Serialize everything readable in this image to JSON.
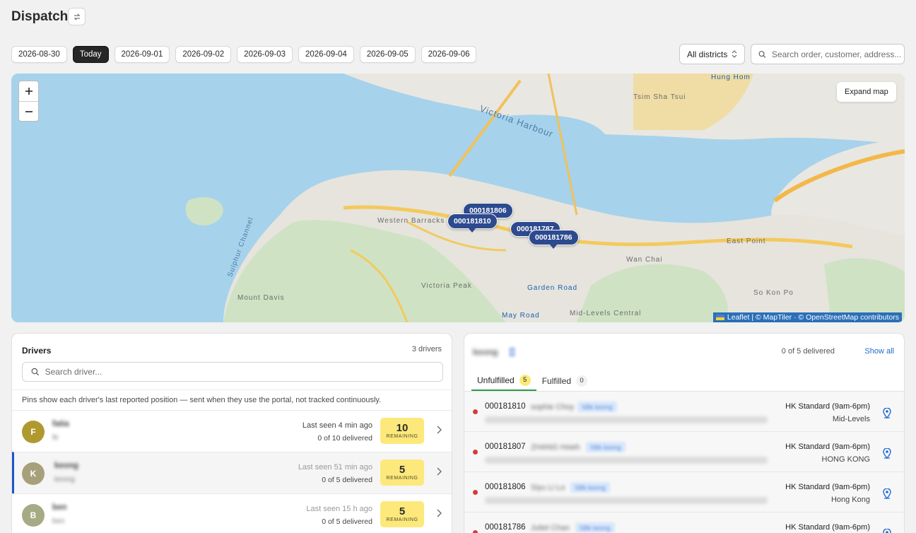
{
  "page": {
    "title": "Dispatch"
  },
  "dates": [
    "2026-08-30",
    "Today",
    "2026-09-01",
    "2026-09-02",
    "2026-09-03",
    "2026-09-04",
    "2026-09-05",
    "2026-09-06"
  ],
  "active_date": "Today",
  "filters": {
    "district": "All districts",
    "search_placeholder": "Search order, customer, address..."
  },
  "map": {
    "expand_label": "Expand map",
    "attribution": "Leaflet | © MapTiler · © OpenStreetMap contributors",
    "labels": [
      "Victoria Harbour",
      "Western Barracks",
      "Sulphur Channel",
      "Victoria Peak",
      "Mount Davis",
      "Wan Chai",
      "East Point",
      "Hung Hom",
      "Tsim Sha Tsui",
      "Garden Road",
      "May Road",
      "Mid-Levels Central",
      "So Kon Po"
    ],
    "pins": [
      "000181806",
      "000181810",
      "000181787",
      "000181786"
    ]
  },
  "drivers": {
    "title": "Drivers",
    "count_label": "3 drivers",
    "search_placeholder": "Search driver...",
    "note": "Pins show each driver's last reported position — sent when they use the portal, not tracked continuously.",
    "remaining_label": "REMAINING",
    "list": [
      {
        "initial": "F",
        "name": "fatia",
        "sub": "fti",
        "last_seen": "Last seen 4 min ago",
        "delivered": "0 of 10 delivered",
        "remaining": "10",
        "color": "#b09a2f",
        "selected": false,
        "faded": false
      },
      {
        "initial": "K",
        "name": "keong",
        "sub": "keong",
        "last_seen": "Last seen 51 min ago",
        "delivered": "0 of 5 delivered",
        "remaining": "5",
        "color": "#a8a07a",
        "selected": true,
        "faded": true
      },
      {
        "initial": "B",
        "name": "ben",
        "sub": "ben",
        "last_seen": "Last seen 15 h ago",
        "delivered": "0 of 5 delivered",
        "remaining": "5",
        "color": "#a7ab85",
        "selected": false,
        "faded": true
      }
    ]
  },
  "orders": {
    "driver_name": "keong",
    "summary": "0 of 5 delivered",
    "show_all": "Show all",
    "tabs": [
      {
        "label": "Unfulfilled",
        "count": "5"
      },
      {
        "label": "Fulfilled",
        "count": "0"
      }
    ],
    "list": [
      {
        "id": "000181810",
        "customer": "sophie Choy",
        "tag": "SBk keong",
        "shipping": "HK Standard (9am-6pm)",
        "area": "Mid-Levels"
      },
      {
        "id": "000181807",
        "customer": "ZHANG Hsieh",
        "tag": "SBk keong",
        "shipping": "HK Standard (9am-6pm)",
        "area": "HONG KONG"
      },
      {
        "id": "000181806",
        "customer": "Siyu Li Lo",
        "tag": "SBk keong",
        "shipping": "HK Standard (9am-6pm)",
        "area": "Hong Kong"
      },
      {
        "id": "000181786",
        "customer": "Juliet Chan",
        "tag": "SBk keong",
        "shipping": "HK Standard (9am-6pm)",
        "area": ""
      }
    ]
  },
  "colors": {
    "accent": "#1d56c9",
    "remaining_bg": "#fde97b",
    "pin": "#2d4a8f",
    "tab_active": "#2f9a4d",
    "status_dot": "#d63c3c"
  },
  "icons": [
    "refresh-icon",
    "chevron-updown-icon",
    "search-icon",
    "plus-icon",
    "minus-icon",
    "chevron-right-icon",
    "location-pin-icon",
    "ukraine-flag-icon"
  ]
}
